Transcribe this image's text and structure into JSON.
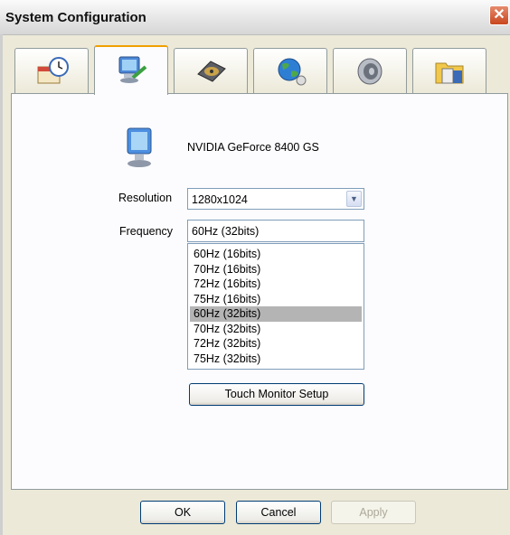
{
  "window": {
    "title": "System Configuration",
    "close_label": "✕"
  },
  "tabs": [
    {
      "name": "datetime",
      "icon": "calendar-clock-icon"
    },
    {
      "name": "display",
      "icon": "monitor-settings-icon",
      "active": true
    },
    {
      "name": "storage",
      "icon": "hard-disk-icon"
    },
    {
      "name": "network",
      "icon": "globe-network-icon"
    },
    {
      "name": "audio",
      "icon": "speaker-icon"
    },
    {
      "name": "system",
      "icon": "system-info-icon"
    }
  ],
  "display": {
    "gpu_name": "NVIDIA GeForce 8400 GS",
    "resolution_label": "Resolution",
    "resolution_value": "1280x1024",
    "frequency_label": "Frequency",
    "frequency_value": "60Hz (32bits)",
    "frequency_options": [
      "60Hz (16bits)",
      "70Hz (16bits)",
      "72Hz (16bits)",
      "75Hz (16bits)",
      "60Hz (32bits)",
      "70Hz (32bits)",
      "72Hz (32bits)",
      "75Hz (32bits)"
    ],
    "selected_option_index": 4,
    "touch_button": "Touch Monitor Setup"
  },
  "footer": {
    "ok": "OK",
    "cancel": "Cancel",
    "apply": "Apply"
  }
}
